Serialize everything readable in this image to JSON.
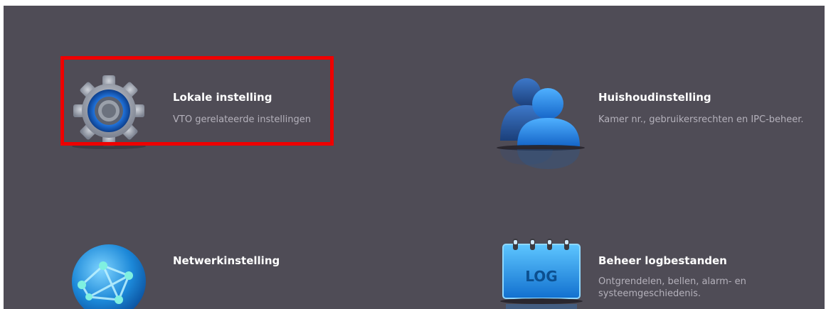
{
  "tiles": {
    "local": {
      "title": "Lokale instelling",
      "desc": "VTO gerelateerde instellingen",
      "icon": "gear-icon"
    },
    "household": {
      "title": "Huishoudinstelling",
      "desc": "Kamer nr., gebruikersrechten en IPC-beheer.",
      "icon": "users-icon"
    },
    "network": {
      "title": "Netwerkinstelling",
      "icon": "globe-icon"
    },
    "logs": {
      "title": "Beheer logbestanden",
      "desc": "Ontgrendelen, bellen, alarm- en systeemgeschiedenis.",
      "icon": "log-icon",
      "icon_text": "LOG"
    }
  },
  "colors": {
    "background": "#4f4c56",
    "highlight": "#ee0000",
    "title": "#ffffff",
    "desc": "#b4b1bb"
  }
}
